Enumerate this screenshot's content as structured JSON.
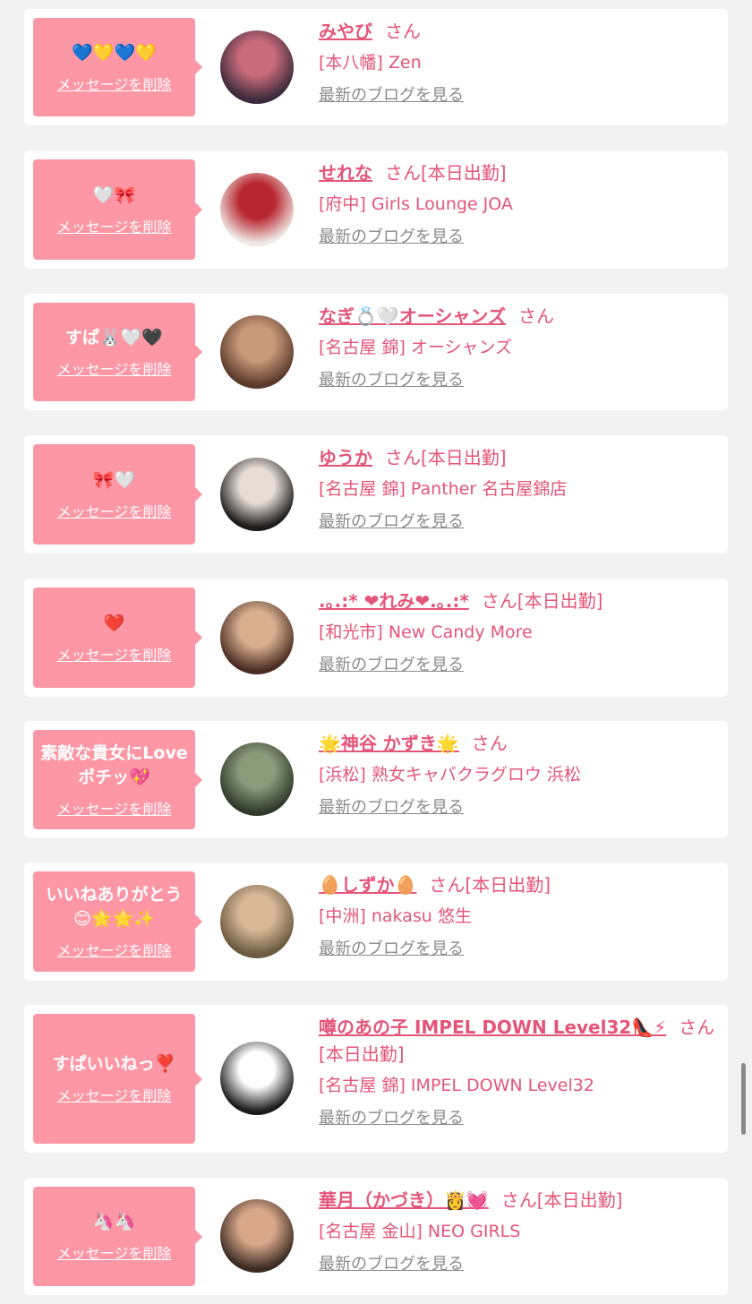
{
  "cards": [
    {
      "message": "💙💛💙💛",
      "delete_label": "メッセージを削除",
      "name": "みやび",
      "suffix": "さん",
      "shop": "[本八幡] Zen",
      "blog_link": "最新のブログを見る",
      "avatar_colors": [
        "#3a2a3a",
        "#c96b7a"
      ]
    },
    {
      "message": "🤍🎀",
      "delete_label": "メッセージを削除",
      "name": "せれな",
      "suffix": "さん[本日出勤]",
      "shop": "[府中] Girls Lounge JOA",
      "blog_link": "最新のブログを見る",
      "avatar_colors": [
        "#efe8e4",
        "#b8262f"
      ]
    },
    {
      "message": "すぱ🐰🤍🖤",
      "delete_label": "メッセージを削除",
      "name": "なぎ💍🤍オーシャンズ",
      "suffix": "さん",
      "shop": "[名古屋 錦] オーシャンズ",
      "blog_link": "最新のブログを見る",
      "avatar_colors": [
        "#5a3a2c",
        "#c99a7a"
      ]
    },
    {
      "message": "🎀🤍",
      "delete_label": "メッセージを削除",
      "name": "ゆうか",
      "suffix": "さん[本日出勤]",
      "shop": "[名古屋 錦] Panther 名古屋錦店",
      "blog_link": "最新のブログを見る",
      "avatar_colors": [
        "#1c1c1c",
        "#e8ddd6"
      ]
    },
    {
      "message": "❤️",
      "delete_label": "メッセージを削除",
      "name": ".｡.:* ❤れみ❤.｡.:*",
      "suffix": "さん[本日出勤]",
      "shop": "[和光市] New Candy More",
      "blog_link": "最新のブログを見る",
      "avatar_colors": [
        "#4a2c22",
        "#d8b090"
      ]
    },
    {
      "message": "素敵な貴女にLove ポチッ💖",
      "delete_label": "メッセージを削除",
      "name": "🌟神谷 かずき🌟",
      "suffix": "さん",
      "shop": "[浜松] 熟女キャバクラグロウ 浜松",
      "blog_link": "最新のブログを見る",
      "avatar_colors": [
        "#2f3a2a",
        "#8a9a7a"
      ]
    },
    {
      "message": "いいねありがとう 😊🌟🌟✨",
      "delete_label": "メッセージを削除",
      "name": "🥚しずか🥚",
      "suffix": "さん[本日出勤]",
      "shop": "[中洲] nakasu 悠生",
      "blog_link": "最新のブログを見る",
      "avatar_colors": [
        "#6a5a40",
        "#d8b898"
      ]
    },
    {
      "message": "すぱいいねっ❣️",
      "delete_label": "メッセージを削除",
      "name": "噂のあの子 IMPEL DOWN Level32👠⚡",
      "suffix": "さん[本日出勤]",
      "shop": "[名古屋 錦] IMPEL DOWN Level32",
      "blog_link": "最新のブログを見る",
      "avatar_colors": [
        "#1a1a1a",
        "#ffffff"
      ]
    },
    {
      "message": "🦄🦄",
      "delete_label": "メッセージを削除",
      "name": "華月（かづき）👸💓",
      "suffix": "さん[本日出勤]",
      "shop": "[名古屋 金山] NEO GIRLS",
      "blog_link": "最新のブログを見る",
      "avatar_colors": [
        "#3a2a22",
        "#d9a88a"
      ]
    }
  ]
}
